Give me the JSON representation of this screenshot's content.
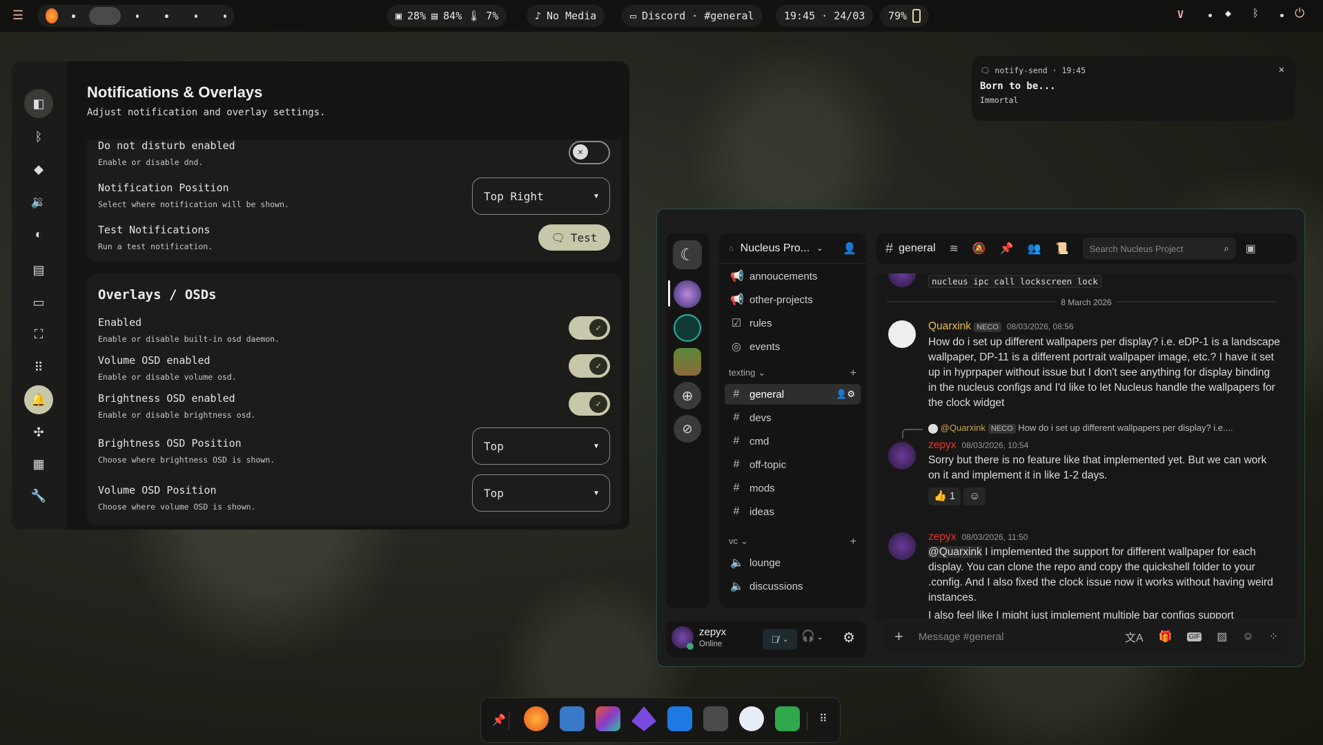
{
  "topbar": {
    "cpu": "28%",
    "ram": "84%",
    "temp": "7%",
    "media": "No Media",
    "window": "Discord · #general",
    "clock": "19:45 · 24/03",
    "battery": "79%"
  },
  "settings": {
    "title": "Notifications & Overlays",
    "subtitle": "Adjust notification and overlay settings.",
    "dnd": {
      "label": "Do not disturb enabled",
      "desc": "Enable or disable dnd.",
      "enabled": false
    },
    "position": {
      "label": "Notification Position",
      "desc": "Select where notification will be shown.",
      "value": "Top Right"
    },
    "test": {
      "label": "Test Notifications",
      "desc": "Run a test notification.",
      "button": "Test"
    },
    "overlays": {
      "title": "Overlays / OSDs",
      "enabled": {
        "label": "Enabled",
        "desc": "Enable or disable built-in osd daemon.",
        "enabled": true
      },
      "volume": {
        "label": "Volume OSD enabled",
        "desc": "Enable or disable volume osd.",
        "enabled": true
      },
      "brightness": {
        "label": "Brightness OSD enabled",
        "desc": "Enable or disable brightness osd.",
        "enabled": true
      },
      "brightness_pos": {
        "label": "Brightness OSD Position",
        "desc": "Choose where brightness OSD is shown.",
        "value": "Top"
      },
      "volume_pos": {
        "label": "Volume OSD Position",
        "desc": "Choose where volume OSD is shown.",
        "value": "Top"
      }
    }
  },
  "notification": {
    "app": "notify-send · 19:45",
    "title": "Born to be...",
    "body": "Immortal"
  },
  "discord": {
    "server": "Nucleus Pro...",
    "channel": "general",
    "search_placeholder": "Search Nucleus Project",
    "channels_top": [
      "annoucements",
      "other-projects",
      "rules",
      "events"
    ],
    "category_text": "texting",
    "text_channels": [
      "general",
      "devs",
      "cmd",
      "off-topic",
      "mods",
      "ideas"
    ],
    "category_voice": "vc",
    "voice_channels": [
      "lounge",
      "discussions"
    ],
    "user": {
      "name": "zepyx",
      "status": "Online"
    },
    "code_line": "nucleus ipc call lockscreen lock",
    "date_divider": "8 March 2026",
    "messages": [
      {
        "author": "Quarxink",
        "tag": "NECO",
        "time": "08/03/2026, 08:56",
        "text": "How do i set up different wallpapers per display? i.e. eDP-1 is a landscape wallpaper, DP-11 is a different portrait wallpaper image, etc.? I have it set up in hyprpaper without issue but I don't see anything for display binding in the nucleus configs and I'd like to let Nucleus handle the wallpapers for the clock widget"
      },
      {
        "reply_to": "@Quarxink",
        "reply_tag": "NECO",
        "reply_text": "How do i set up different wallpapers per display? i.e....",
        "author": "zepyx",
        "time": "08/03/2026, 10:54",
        "text": "Sorry but there is no feature like that implemented yet. But we can work on it and implement it in like 1-2 days.",
        "reaction_count": "1"
      },
      {
        "author": "zepyx",
        "time": "08/03/2026, 11:50",
        "mention": "@Quarxink",
        "text": " I implemented the support for different wallpaper for each display. You can clone the repo and copy the quickshell folder to your .config. And I also fixed the clock issue now it works without having weird instances.",
        "text2": "I also feel like I might just implement multiple bar configs support"
      }
    ],
    "input_placeholder": "Message #general"
  }
}
